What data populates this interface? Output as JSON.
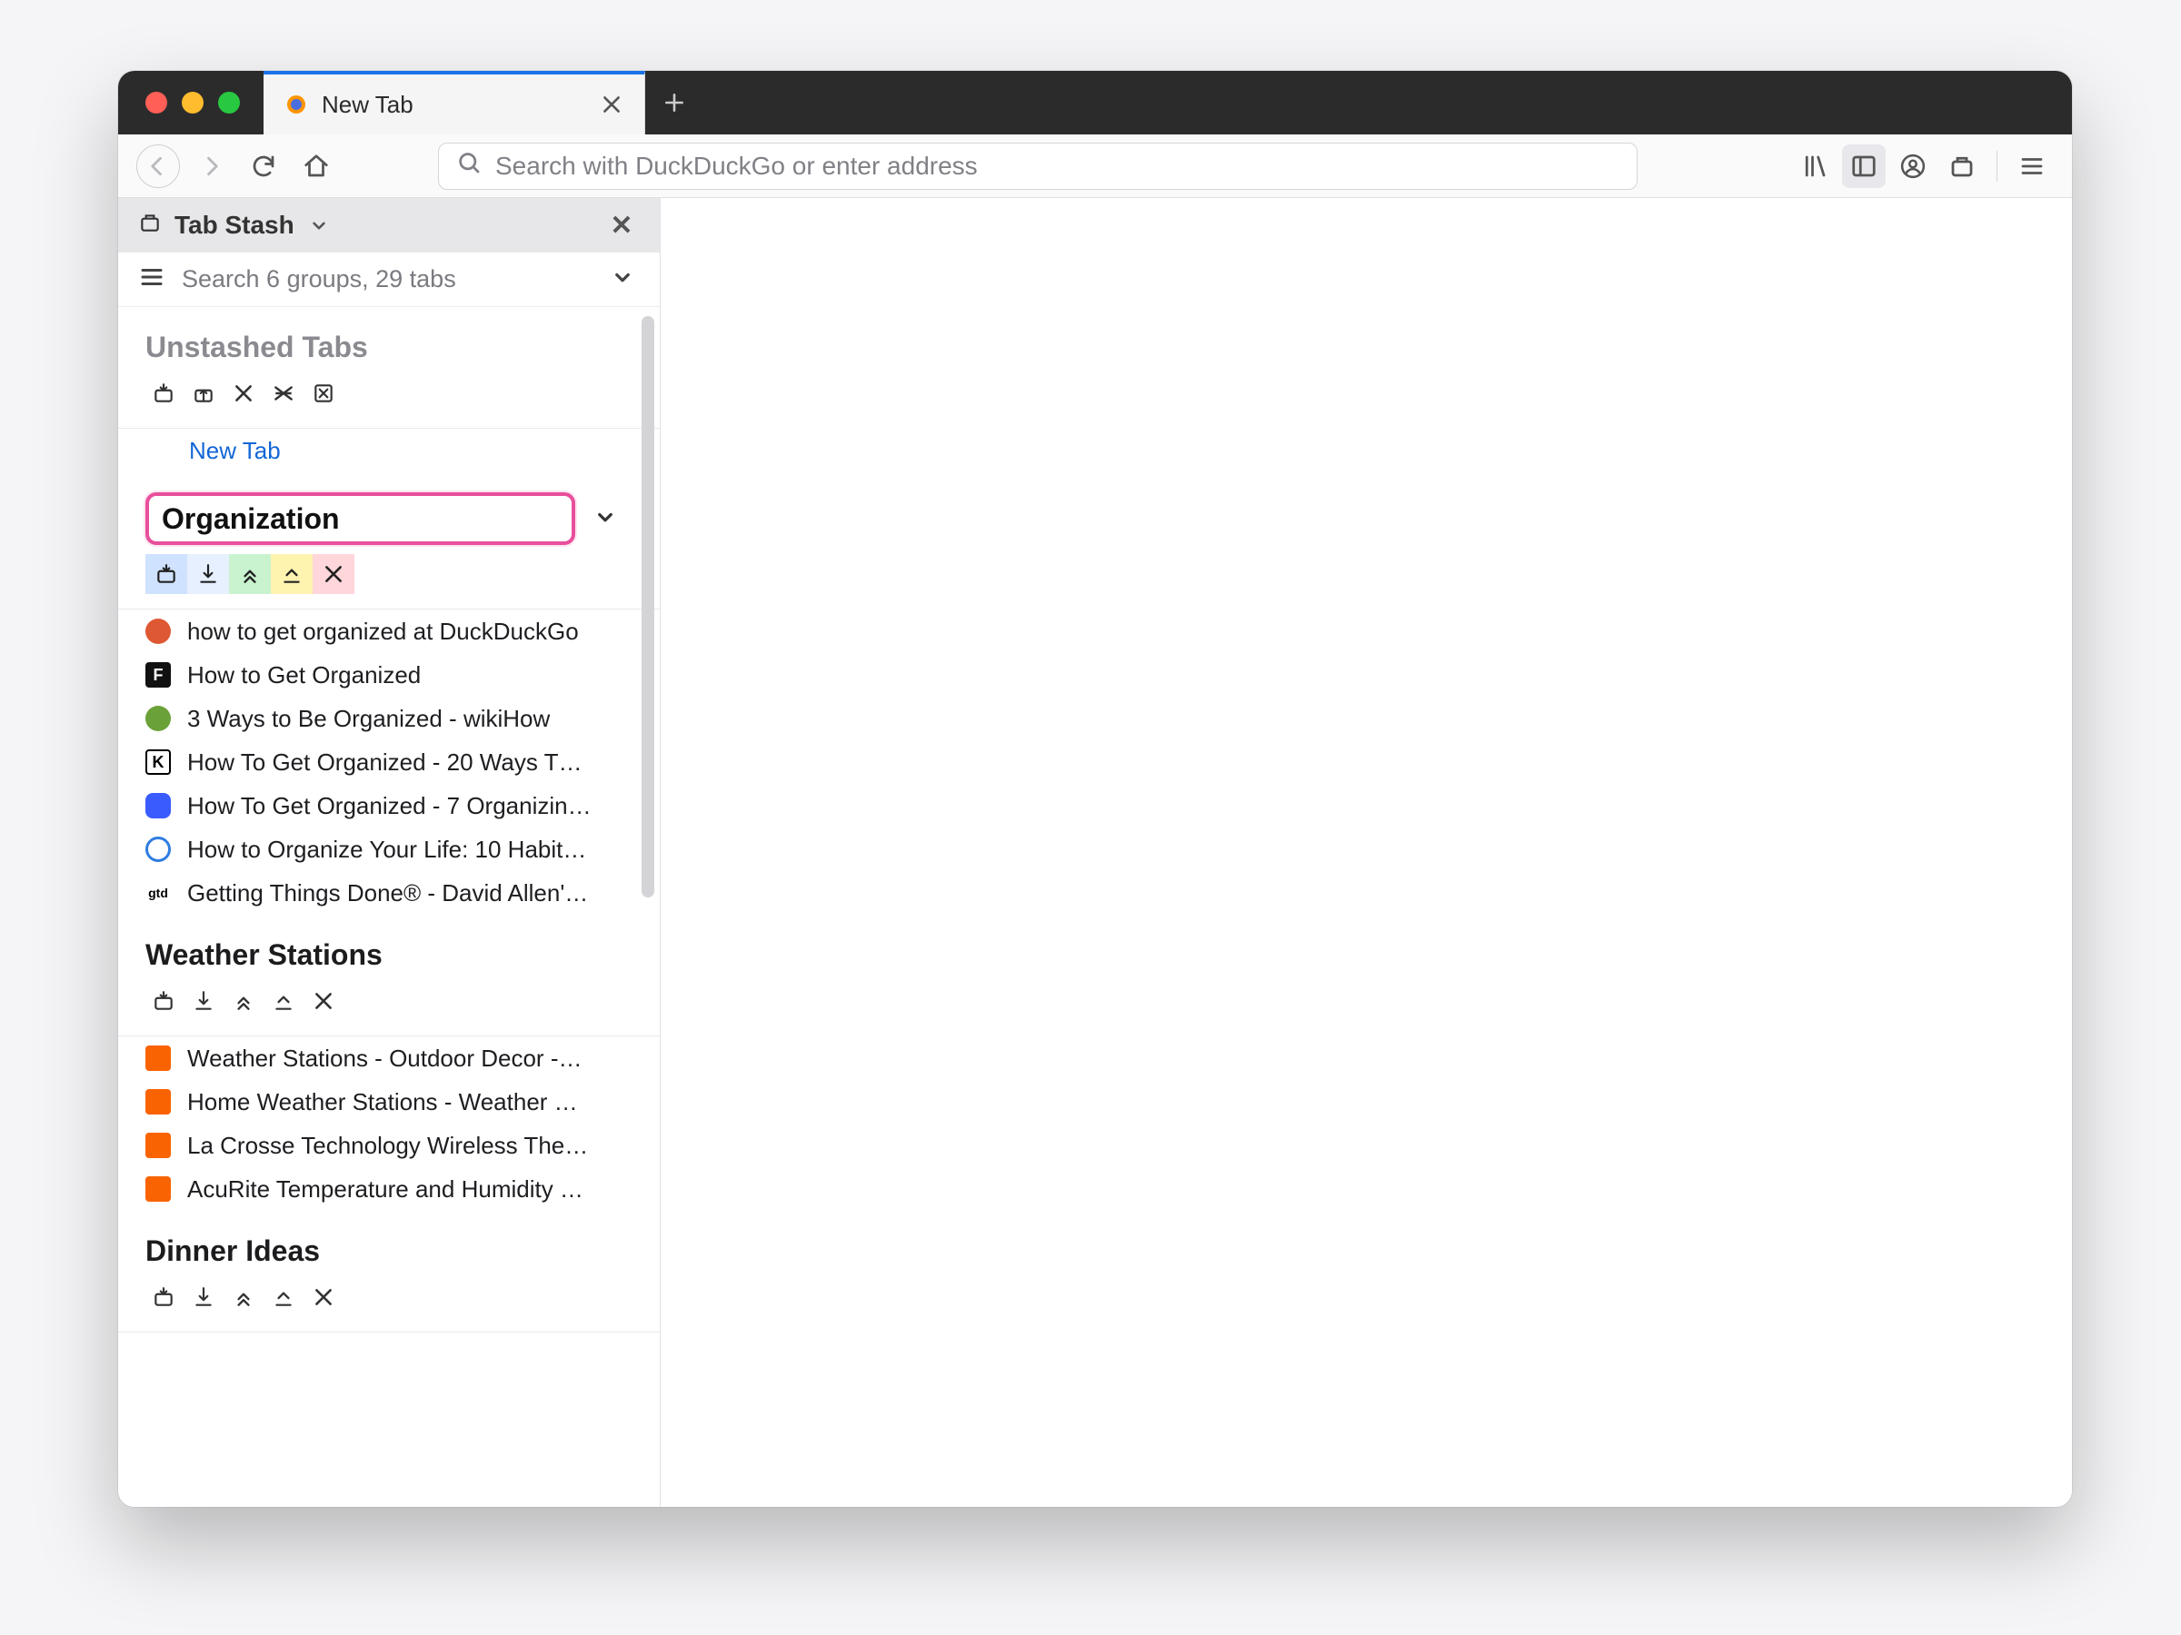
{
  "browser_tab": {
    "title": "New Tab"
  },
  "urlbar": {
    "placeholder": "Search with DuckDuckGo or enter address"
  },
  "sidebar": {
    "title": "Tab Stash",
    "search_placeholder": "Search 6 groups, 29 tabs",
    "unstashed": {
      "title": "Unstashed Tabs",
      "new_tab_label": "New Tab"
    },
    "editing_group": {
      "value": "Organization",
      "items": [
        "how to get organized at DuckDuckGo",
        "How to Get Organized",
        "3 Ways to Be Organized - wikiHow",
        "How To Get Organized - 20 Ways T…",
        "How To Get Organized - 7 Organizin…",
        "How to Organize Your Life: 10 Habit…",
        "Getting Things Done® - David Allen'…"
      ]
    },
    "groups": [
      {
        "title": "Weather Stations",
        "items": [
          "Weather Stations - Outdoor Decor -…",
          "Home Weather Stations - Weather …",
          "La Crosse Technology Wireless The…",
          "AcuRite Temperature and Humidity …"
        ]
      },
      {
        "title": "Dinner Ideas",
        "items": []
      }
    ]
  }
}
